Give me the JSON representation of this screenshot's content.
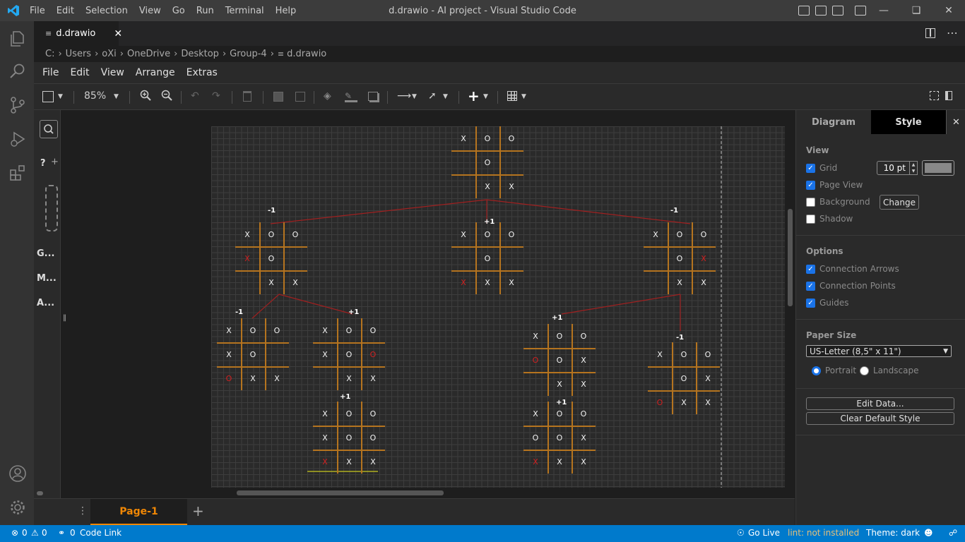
{
  "window": {
    "title": "d.drawio - AI project - Visual Studio Code",
    "menu": [
      "File",
      "Edit",
      "Selection",
      "View",
      "Go",
      "Run",
      "Terminal",
      "Help"
    ]
  },
  "tab": {
    "label": "d.drawio"
  },
  "breadcrumb": [
    "C:",
    "Users",
    "oXi",
    "OneDrive",
    "Desktop",
    "Group-4",
    "d.drawio"
  ],
  "drawio_menu": [
    "File",
    "Edit",
    "View",
    "Arrange",
    "Extras"
  ],
  "toolbar": {
    "zoom": "85%"
  },
  "shapes_panel": {
    "help": "?",
    "groups": [
      "G...",
      "M...",
      "A..."
    ],
    "bottom": "+..."
  },
  "canvas": {
    "boards": [
      {
        "cells": [
          "X",
          "O",
          "O",
          "",
          "O",
          "",
          "",
          "X",
          "X"
        ],
        "red": [],
        "score": ""
      },
      {
        "cells": [
          "X",
          "O",
          "O",
          "X",
          "O",
          "",
          "",
          "X",
          "X"
        ],
        "red": [
          3
        ],
        "score": "-1"
      },
      {
        "cells": [
          "X",
          "O",
          "O",
          "",
          "O",
          "",
          "X",
          "X",
          "X"
        ],
        "red": [
          6
        ],
        "score": "+1"
      },
      {
        "cells": [
          "X",
          "O",
          "O",
          "",
          "O",
          "X",
          "",
          "X",
          "X"
        ],
        "red": [
          5
        ],
        "score": "-1"
      },
      {
        "cells": [
          "X",
          "O",
          "O",
          "X",
          "O",
          "",
          "O",
          "X",
          "X"
        ],
        "red": [
          6
        ],
        "score": "-1"
      },
      {
        "cells": [
          "X",
          "O",
          "O",
          "X",
          "O",
          "O",
          "",
          "X",
          "X"
        ],
        "red": [
          5
        ],
        "score": "+1"
      },
      {
        "cells": [
          "X",
          "O",
          "O",
          "X",
          "O",
          "O",
          "X",
          "X",
          "X"
        ],
        "red": [
          6
        ],
        "score": "+1"
      },
      {
        "cells": [
          "X",
          "O",
          "O",
          "O",
          "O",
          "X",
          "",
          "X",
          "X"
        ],
        "red": [
          3
        ],
        "score": "+1"
      },
      {
        "cells": [
          "X",
          "O",
          "O",
          "O",
          "O",
          "X",
          "X",
          "X",
          "X"
        ],
        "red": [
          6
        ],
        "score": "+1"
      },
      {
        "cells": [
          "X",
          "O",
          "O",
          "",
          "O",
          "X",
          "O",
          "X",
          "X"
        ],
        "red": [
          6
        ],
        "score": "-1"
      }
    ]
  },
  "page_tab": {
    "label": "Page-1"
  },
  "format_panel": {
    "tabs": [
      "Diagram",
      "Style"
    ],
    "view_title": "View",
    "grid": "Grid",
    "grid_size": "10 pt",
    "page_view": "Page View",
    "background": "Background",
    "change": "Change",
    "shadow": "Shadow",
    "options_title": "Options",
    "connection_arrows": "Connection Arrows",
    "connection_points": "Connection Points",
    "guides": "Guides",
    "paper_size_title": "Paper Size",
    "paper_size": "US-Letter (8,5\" x 11\")",
    "portrait": "Portrait",
    "landscape": "Landscape",
    "edit_data": "Edit Data...",
    "clear_default_style": "Clear Default Style"
  },
  "status_bar": {
    "problems": "0",
    "warnings": "0",
    "ports": "0",
    "code_link": "Code Link",
    "go_live": "Go Live",
    "lint": "lint: not installed",
    "theme": "Theme: dark"
  },
  "colors": {
    "accent": "#007acc",
    "drawio_orange": "#f08705",
    "board_lines": "#b5741f",
    "red_mark": "#d02020",
    "edge": "#a02020"
  }
}
